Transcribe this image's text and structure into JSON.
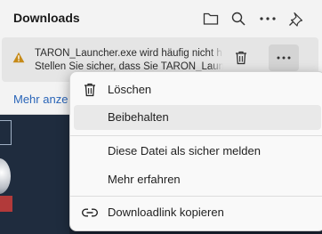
{
  "panel": {
    "title": "Downloads",
    "header_icons": [
      "folder-icon",
      "search-icon",
      "more-icon",
      "pin-icon"
    ]
  },
  "download_item": {
    "line1": "TARON_Launcher.exe wird häufig nicht h",
    "line2": "Stellen Sie sicher, dass Sie TARON_Laun",
    "warning_color": "#c68a18"
  },
  "show_more_label": "Mehr anze",
  "menu": {
    "items": [
      {
        "label": "Löschen",
        "icon": "trash-icon"
      },
      {
        "label": "Beibehalten",
        "icon": ""
      },
      {
        "label": "Diese Datei als sicher melden",
        "icon": ""
      },
      {
        "label": "Mehr erfahren",
        "icon": ""
      },
      {
        "label": "Downloadlink kopieren",
        "icon": "link-icon"
      }
    ]
  },
  "colors": {
    "link": "#2a65b8",
    "hover": "#e9e9e9"
  }
}
